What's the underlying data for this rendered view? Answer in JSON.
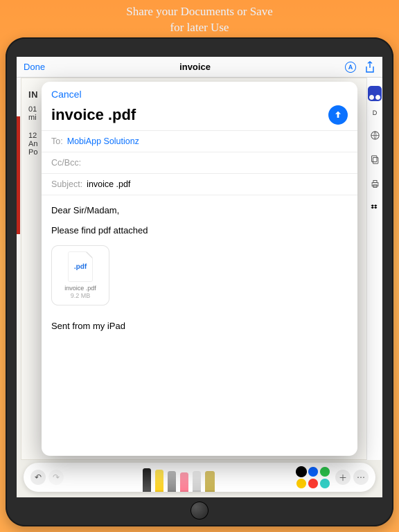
{
  "caption_line1": "Share your Documents or Save",
  "caption_line2": "for later Use",
  "viewer": {
    "done": "Done",
    "title": "invoice",
    "markup_badge": "A",
    "bg_heading": "IN",
    "bg_line1": "01",
    "bg_line2": "mi",
    "bg_addr1": "12",
    "bg_addr2": "An",
    "bg_addr3": "Po",
    "side_label": "D"
  },
  "compose": {
    "cancel": "Cancel",
    "title": "invoice .pdf",
    "to_label": "To:",
    "to_value": "MobiApp Solutionz",
    "ccbcc_label": "Cc/Bcc:",
    "subject_label": "Subject:",
    "subject_value": "invoice .pdf",
    "greeting": "Dear Sir/Madam,",
    "body_line": "Please find pdf attached",
    "attachment": {
      "badge": ".pdf",
      "name": "invoice .pdf",
      "size": "9.2 MB"
    },
    "signature": "Sent from my iPad"
  },
  "markup_colors": {
    "black": "#000000",
    "blue": "#0a63ff",
    "green": "#2bc24b",
    "yellow": "#ffcc00",
    "red": "#ff3b30",
    "teal": "#34d0c6"
  }
}
